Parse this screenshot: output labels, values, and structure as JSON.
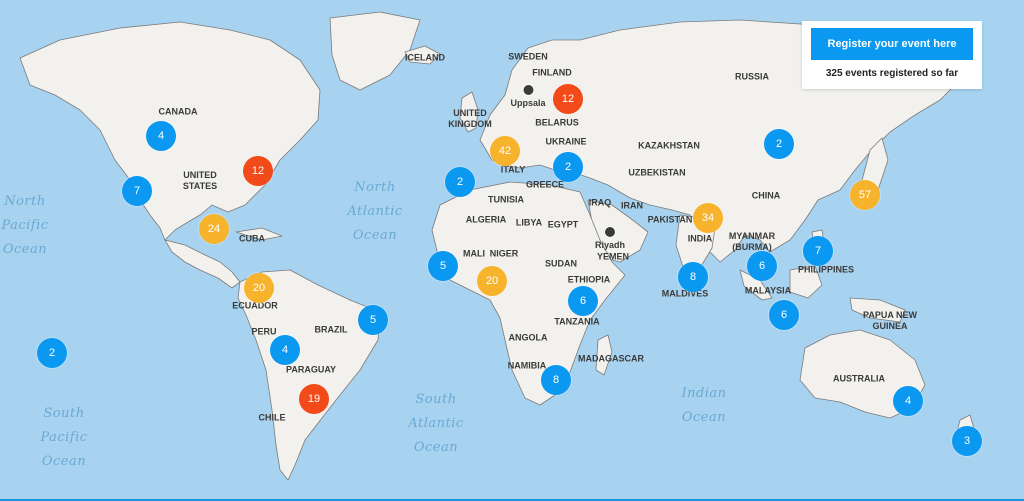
{
  "colors": {
    "ocean": "#a8d3f0",
    "land": "#f2f1ee",
    "border": "#7a7a7a",
    "cluster_blue": "#0a98f0",
    "cluster_orange": "#f7b32b",
    "cluster_red": "#f24a18"
  },
  "register": {
    "button_label": "Register your event here",
    "count_text": "325 events registered so far"
  },
  "oceans": [
    "North\nPacific\nOcean",
    "North\nAtlantic\nOcean",
    "South\nPacific\nOcean",
    "South\nAtlantic\nOcean",
    "Indian\nOcean"
  ],
  "countries": [
    "CANADA",
    "UNITED\nSTATES",
    "CUBA",
    "ECUADOR",
    "PERU",
    "BRAZIL",
    "PARAGUAY",
    "CHILE",
    "ICELAND",
    "SWEDEN",
    "FINLAND",
    "UNITED\nKINGDOM",
    "BELARUS",
    "UKRAINE",
    "ITALY",
    "GREECE",
    "RUSSIA",
    "KAZAKHSTAN",
    "UZBEKISTAN",
    "TUNISIA",
    "ALGERIA",
    "LIBYA",
    "EGYPT",
    "IRAQ",
    "IRAN",
    "PAKISTAN",
    "CHINA",
    "INDIA",
    "MYANMAR\n(BURMA)",
    "MALI",
    "NIGER",
    "SUDAN",
    "YEMEN",
    "ETHIOPIA",
    "TANZANIA",
    "ANGOLA",
    "NAMIBIA",
    "MADAGASCAR",
    "MALDIVES",
    "MALAYSIA",
    "PHILIPPINES",
    "PAPUA NEW\nGUINEA",
    "AUSTRALIA"
  ],
  "pins": [
    "Uppsala",
    "Riyadh"
  ],
  "clusters": [
    {
      "count": "4",
      "level": "blue"
    },
    {
      "count": "7",
      "level": "blue"
    },
    {
      "count": "12",
      "level": "red"
    },
    {
      "count": "24",
      "level": "orange"
    },
    {
      "count": "20",
      "level": "orange"
    },
    {
      "count": "5",
      "level": "blue"
    },
    {
      "count": "4",
      "level": "blue"
    },
    {
      "count": "19",
      "level": "red"
    },
    {
      "count": "2",
      "level": "blue"
    },
    {
      "count": "12",
      "level": "red"
    },
    {
      "count": "42",
      "level": "orange"
    },
    {
      "count": "2",
      "level": "blue"
    },
    {
      "count": "2",
      "level": "blue"
    },
    {
      "count": "5",
      "level": "blue"
    },
    {
      "count": "20",
      "level": "orange"
    },
    {
      "count": "6",
      "level": "blue"
    },
    {
      "count": "8",
      "level": "blue"
    },
    {
      "count": "34",
      "level": "orange"
    },
    {
      "count": "8",
      "level": "blue"
    },
    {
      "count": "6",
      "level": "blue"
    },
    {
      "count": "7",
      "level": "blue"
    },
    {
      "count": "6",
      "level": "blue"
    },
    {
      "count": "2",
      "level": "blue"
    },
    {
      "count": "57",
      "level": "orange"
    },
    {
      "count": "4",
      "level": "blue"
    },
    {
      "count": "3",
      "level": "blue"
    }
  ]
}
